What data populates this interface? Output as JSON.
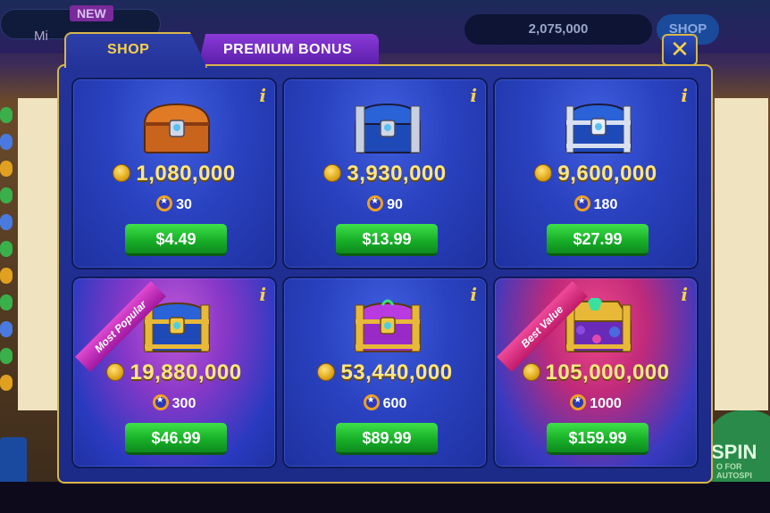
{
  "background": {
    "badge_new": "NEW",
    "player_name_fragment": "Mi",
    "balance": "2,075,000",
    "shop_button": "SHOP",
    "spin_label": "SPIN",
    "spin_sub": "O FOR AUTOSPI"
  },
  "tabs": {
    "shop": "SHOP",
    "premium_bonus": "PREMIUM BONUS"
  },
  "close_label": "✕",
  "offers": [
    {
      "coins": "1,080,000",
      "points": "30",
      "price": "$4.49",
      "chest": "bronze",
      "ribbon": ""
    },
    {
      "coins": "3,930,000",
      "points": "90",
      "price": "$13.99",
      "chest": "silver",
      "ribbon": ""
    },
    {
      "coins": "9,600,000",
      "points": "180",
      "price": "$27.99",
      "chest": "silver-blue",
      "ribbon": ""
    },
    {
      "coins": "19,880,000",
      "points": "300",
      "price": "$46.99",
      "chest": "gold-blue",
      "ribbon": "Most Popular"
    },
    {
      "coins": "53,440,000",
      "points": "600",
      "price": "$89.99",
      "chest": "gold-purple",
      "ribbon": ""
    },
    {
      "coins": "105,000,000",
      "points": "1000",
      "price": "$159.99",
      "chest": "gold-gems",
      "ribbon": "Best Value"
    }
  ],
  "icons": {
    "info": "i",
    "coin": "coin-icon",
    "points": "points-icon"
  },
  "colors": {
    "accent_gold": "#f6d24a",
    "panel_blue": "#24339a",
    "buy_green": "#18b028",
    "premium_purple": "#8a3ad8"
  }
}
